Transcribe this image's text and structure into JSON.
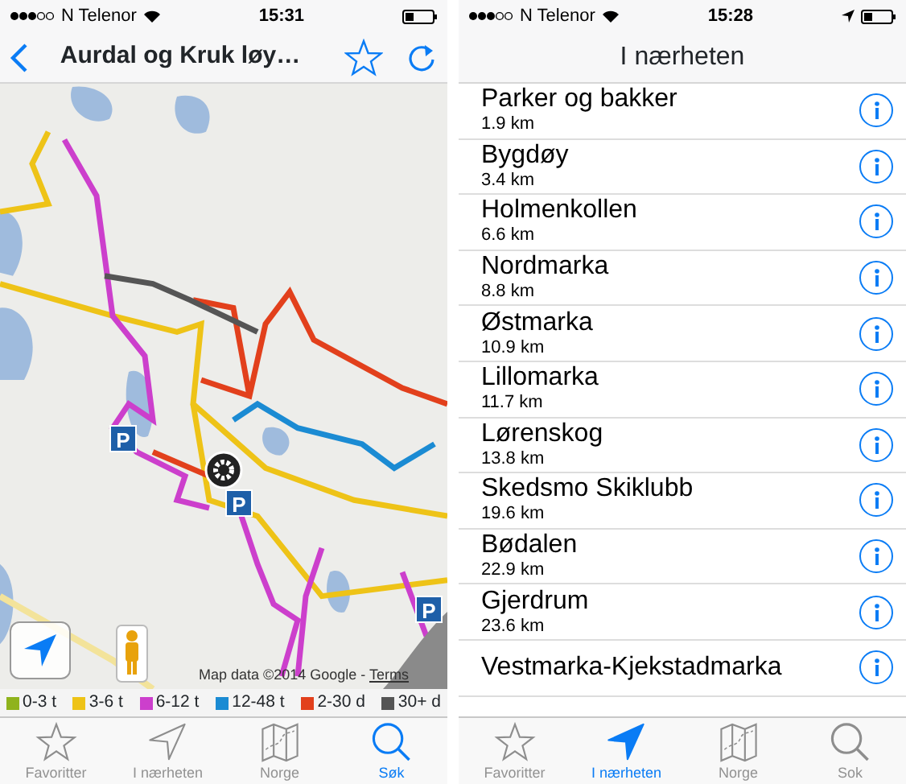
{
  "map_screen": {
    "status_bar": {
      "carrier": "N Telenor",
      "time": "15:31"
    },
    "nav_bar": {
      "title": "Aurdal og Kruk løy…"
    },
    "map": {
      "markers": [
        {
          "kind": "parking",
          "label": "P"
        },
        {
          "kind": "parking",
          "label": "P"
        },
        {
          "kind": "parking",
          "label": "P"
        },
        {
          "kind": "settings"
        }
      ],
      "attribution": "Map data ©2014 Google - ",
      "terms_link": "Terms"
    },
    "legend": [
      {
        "label": "0-3 t",
        "color": "#8fb31d"
      },
      {
        "label": "3-6 t",
        "color": "#eec317"
      },
      {
        "label": "6-12 t",
        "color": "#cc3fcc"
      },
      {
        "label": "12-48 t",
        "color": "#1b8bd3"
      },
      {
        "label": "2-30 d",
        "color": "#e2401c"
      },
      {
        "label": "30+ d",
        "color": "#555555"
      }
    ],
    "tab_bar": [
      {
        "label": "Favoritter",
        "selected": false
      },
      {
        "label": "I nærheten",
        "selected": false
      },
      {
        "label": "Norge",
        "selected": false
      },
      {
        "label": "Søk",
        "selected": true
      }
    ]
  },
  "nearby_screen": {
    "status_bar": {
      "carrier": "N Telenor",
      "time": "15:28"
    },
    "nav_bar": {
      "title": "I nærheten"
    },
    "places": [
      {
        "name": "Parker og bakker",
        "distance": "1.9 km"
      },
      {
        "name": "Bygdøy",
        "distance": "3.4 km"
      },
      {
        "name": "Holmenkollen",
        "distance": "6.6 km"
      },
      {
        "name": "Nordmarka",
        "distance": "8.8 km"
      },
      {
        "name": "Østmarka",
        "distance": "10.9 km"
      },
      {
        "name": "Lillomarka",
        "distance": "11.7 km"
      },
      {
        "name": "Lørenskog",
        "distance": "13.8 km"
      },
      {
        "name": "Skedsmo Skiklubb",
        "distance": "19.6 km"
      },
      {
        "name": "Bødalen",
        "distance": "22.9 km"
      },
      {
        "name": "Gjerdrum",
        "distance": "23.6 km"
      },
      {
        "name": "Vestmarka-Kjekstadmarka"
      }
    ],
    "tab_bar": [
      {
        "label": "Favoritter",
        "selected": false
      },
      {
        "label": "I nærheten",
        "selected": true
      },
      {
        "label": "Norge",
        "selected": false
      },
      {
        "label": "Sok",
        "selected": false
      }
    ]
  }
}
